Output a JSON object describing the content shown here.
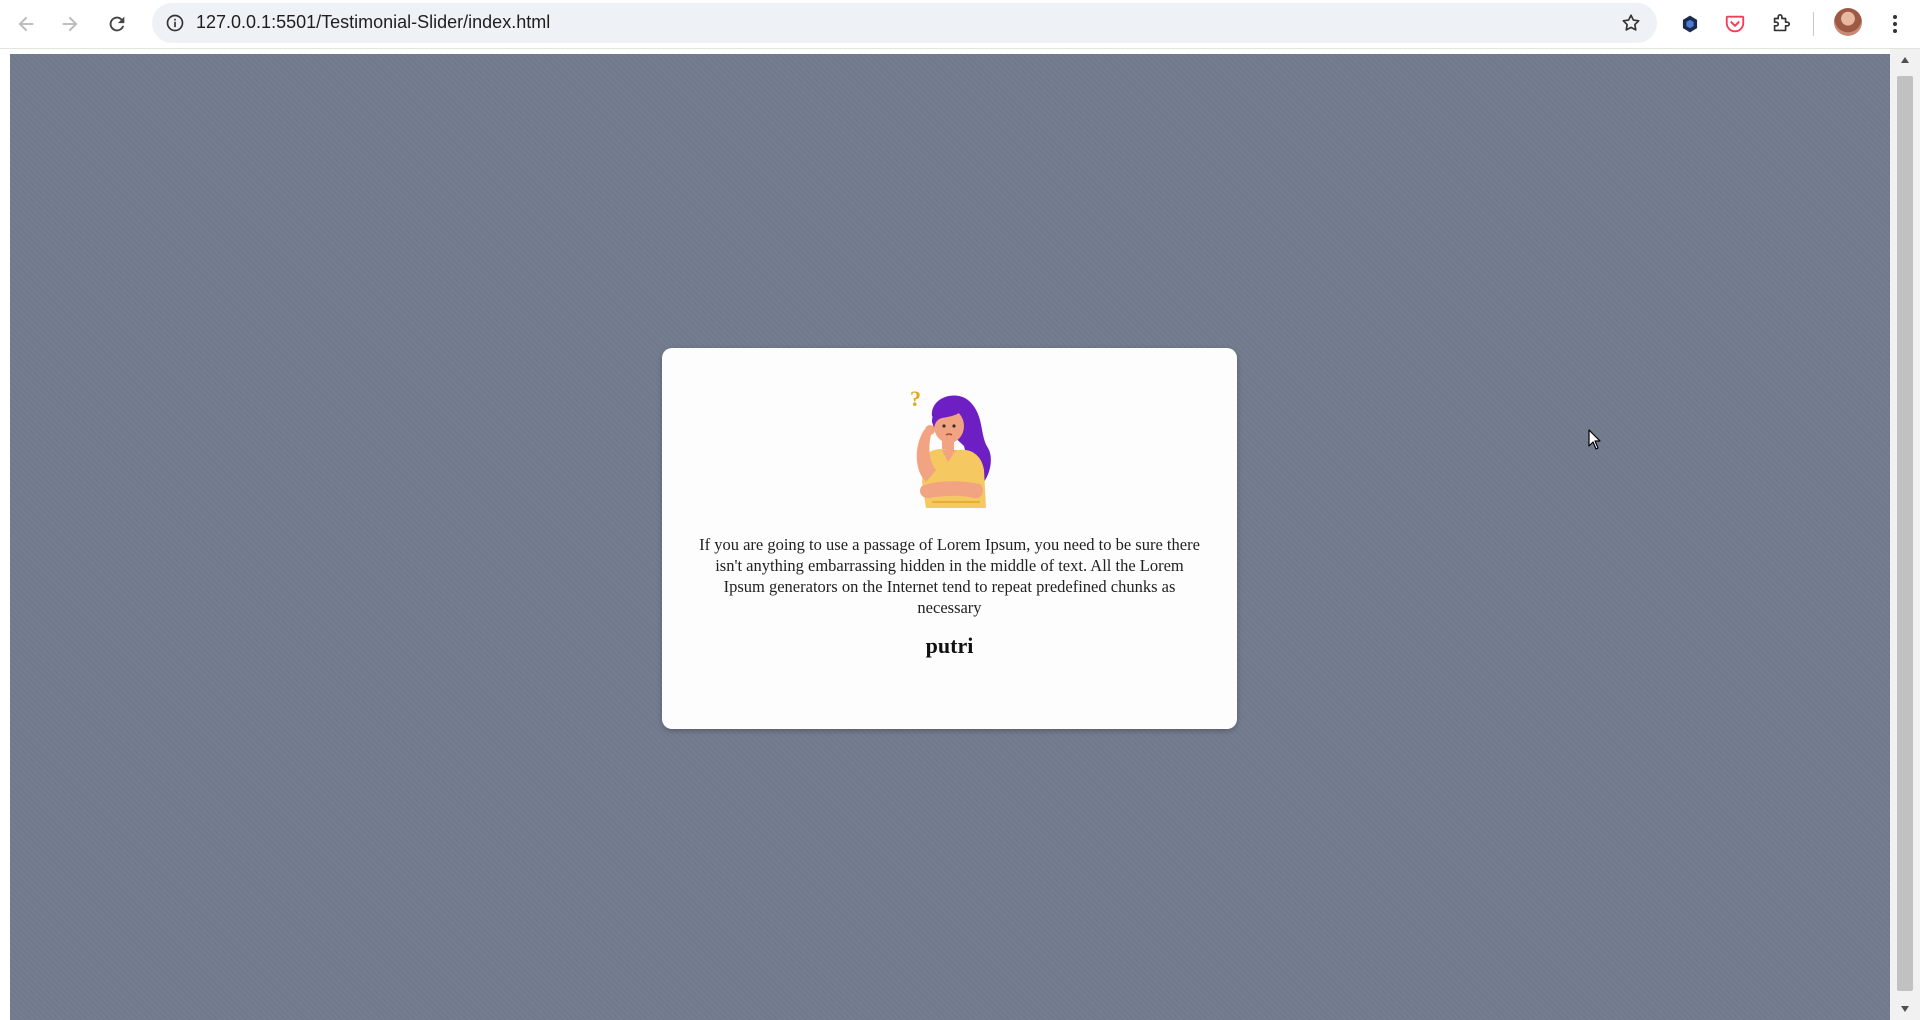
{
  "browser": {
    "url": "127.0.0.1:5501/Testimonial-Slider/index.html",
    "icons": {
      "back": "back-arrow-icon",
      "forward": "forward-arrow-icon",
      "reload": "reload-icon",
      "info": "info-icon",
      "bookmark": "star-icon",
      "extension1": "hexagon-extension-icon",
      "pocket": "pocket-icon",
      "extensions": "puzzle-icon",
      "menu": "kebab-menu-icon"
    }
  },
  "page": {
    "background_color": "#737c8f",
    "testimonial": {
      "quote": "If you are going to use a passage of Lorem Ipsum, you need to be sure there isn't anything embarrassing hidden in the middle of text. All the Lorem Ipsum generators on the Internet tend to repeat predefined chunks as necessary",
      "author": "putri",
      "illustration": "thinking-woman-illustration"
    }
  },
  "colors": {
    "page_bg": "#737c8f",
    "card_bg": "#fdfdfd",
    "hair": "#6d1fc4",
    "shirt": "#f5c862",
    "skin": "#f2a382",
    "question_mark": "#e0a820"
  }
}
